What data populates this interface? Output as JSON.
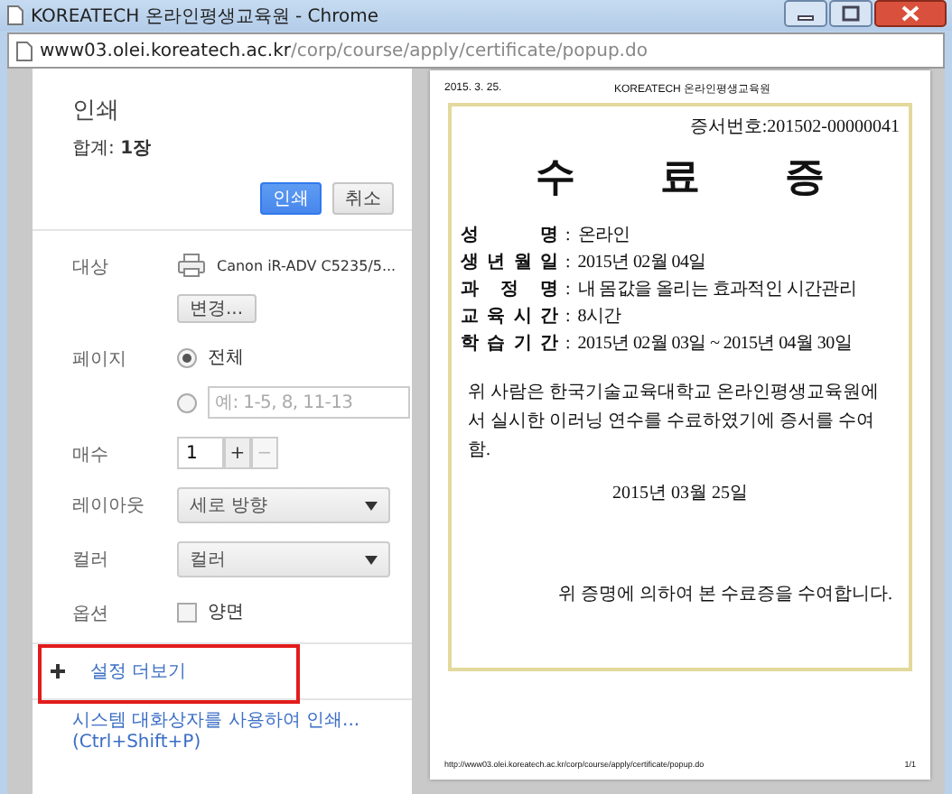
{
  "window": {
    "title": "KOREATECH 온라인평생교육원 - Chrome"
  },
  "address_bar": {
    "domain": "www03.olei.koreatech.ac.kr",
    "path": "/corp/course/apply/certificate/popup.do"
  },
  "print_panel": {
    "title": "인쇄",
    "total_label": "합계:",
    "total_value": "1장",
    "buttons": [
      {
        "label": "인쇄",
        "kind": "primary"
      },
      {
        "label": "취소",
        "kind": "secondary"
      }
    ],
    "settings": [
      {
        "kind": "destination",
        "label": "대상",
        "printer": "Canon iR-ADV C5235/5...",
        "change_button": "변경..."
      },
      {
        "kind": "pages",
        "label": "페이지",
        "options": [
          {
            "label": "전체",
            "selected": true
          },
          {
            "placeholder": "예: 1-5, 8, 11-13",
            "selected": false
          }
        ]
      },
      {
        "kind": "copies",
        "label": "매수",
        "value": "1",
        "buttons": [
          {
            "label": "+",
            "disabled": false
          },
          {
            "label": "−",
            "disabled": true
          }
        ]
      },
      {
        "kind": "select",
        "label": "레이아웃",
        "value": "세로 방향"
      },
      {
        "kind": "select",
        "label": "컬러",
        "value": "컬러"
      },
      {
        "kind": "checkbox",
        "label": "옵션",
        "option": "양면",
        "checked": false
      }
    ],
    "more_settings": "설정 더보기",
    "system_dialog_link": "시스템 대화상자를 사용하여 인쇄... (Ctrl+Shift+P)"
  },
  "preview": {
    "header_date": "2015. 3. 25.",
    "header_site": "KOREATECH 온라인평생교육원",
    "certificate": {
      "number": "증서번호:201502-00000041",
      "title": [
        "수",
        "료",
        "증"
      ],
      "fields": [
        {
          "label": "성 명",
          "colon": ":",
          "value": "온라인"
        },
        {
          "label": "생 년 월 일",
          "colon": ":",
          "value": "2015년 02월 04일"
        },
        {
          "label": "과 정 명",
          "colon": ":",
          "value": "내 몸값을 올리는 효과적인 시간관리"
        },
        {
          "label": "교 육 시 간",
          "colon": ":",
          "value": "8시간"
        },
        {
          "label": "학 습 기 간",
          "colon": ":",
          "value": "2015년 02월 03일 ~ 2015년 04월 30일"
        }
      ],
      "statement": "위 사람은 한국기술교육대학교 온라인평생교육원에서 실시한 이러닝 연수를 수료하였기에 증서를 수여함.",
      "date": "2015년 03월 25일",
      "closing": "위 증명에 의하여 본 수료증을 수여합니다."
    },
    "footer_url": "http://www03.olei.koreatech.ac.kr/corp/course/apply/certificate/popup.do",
    "footer_page": "1/1"
  }
}
